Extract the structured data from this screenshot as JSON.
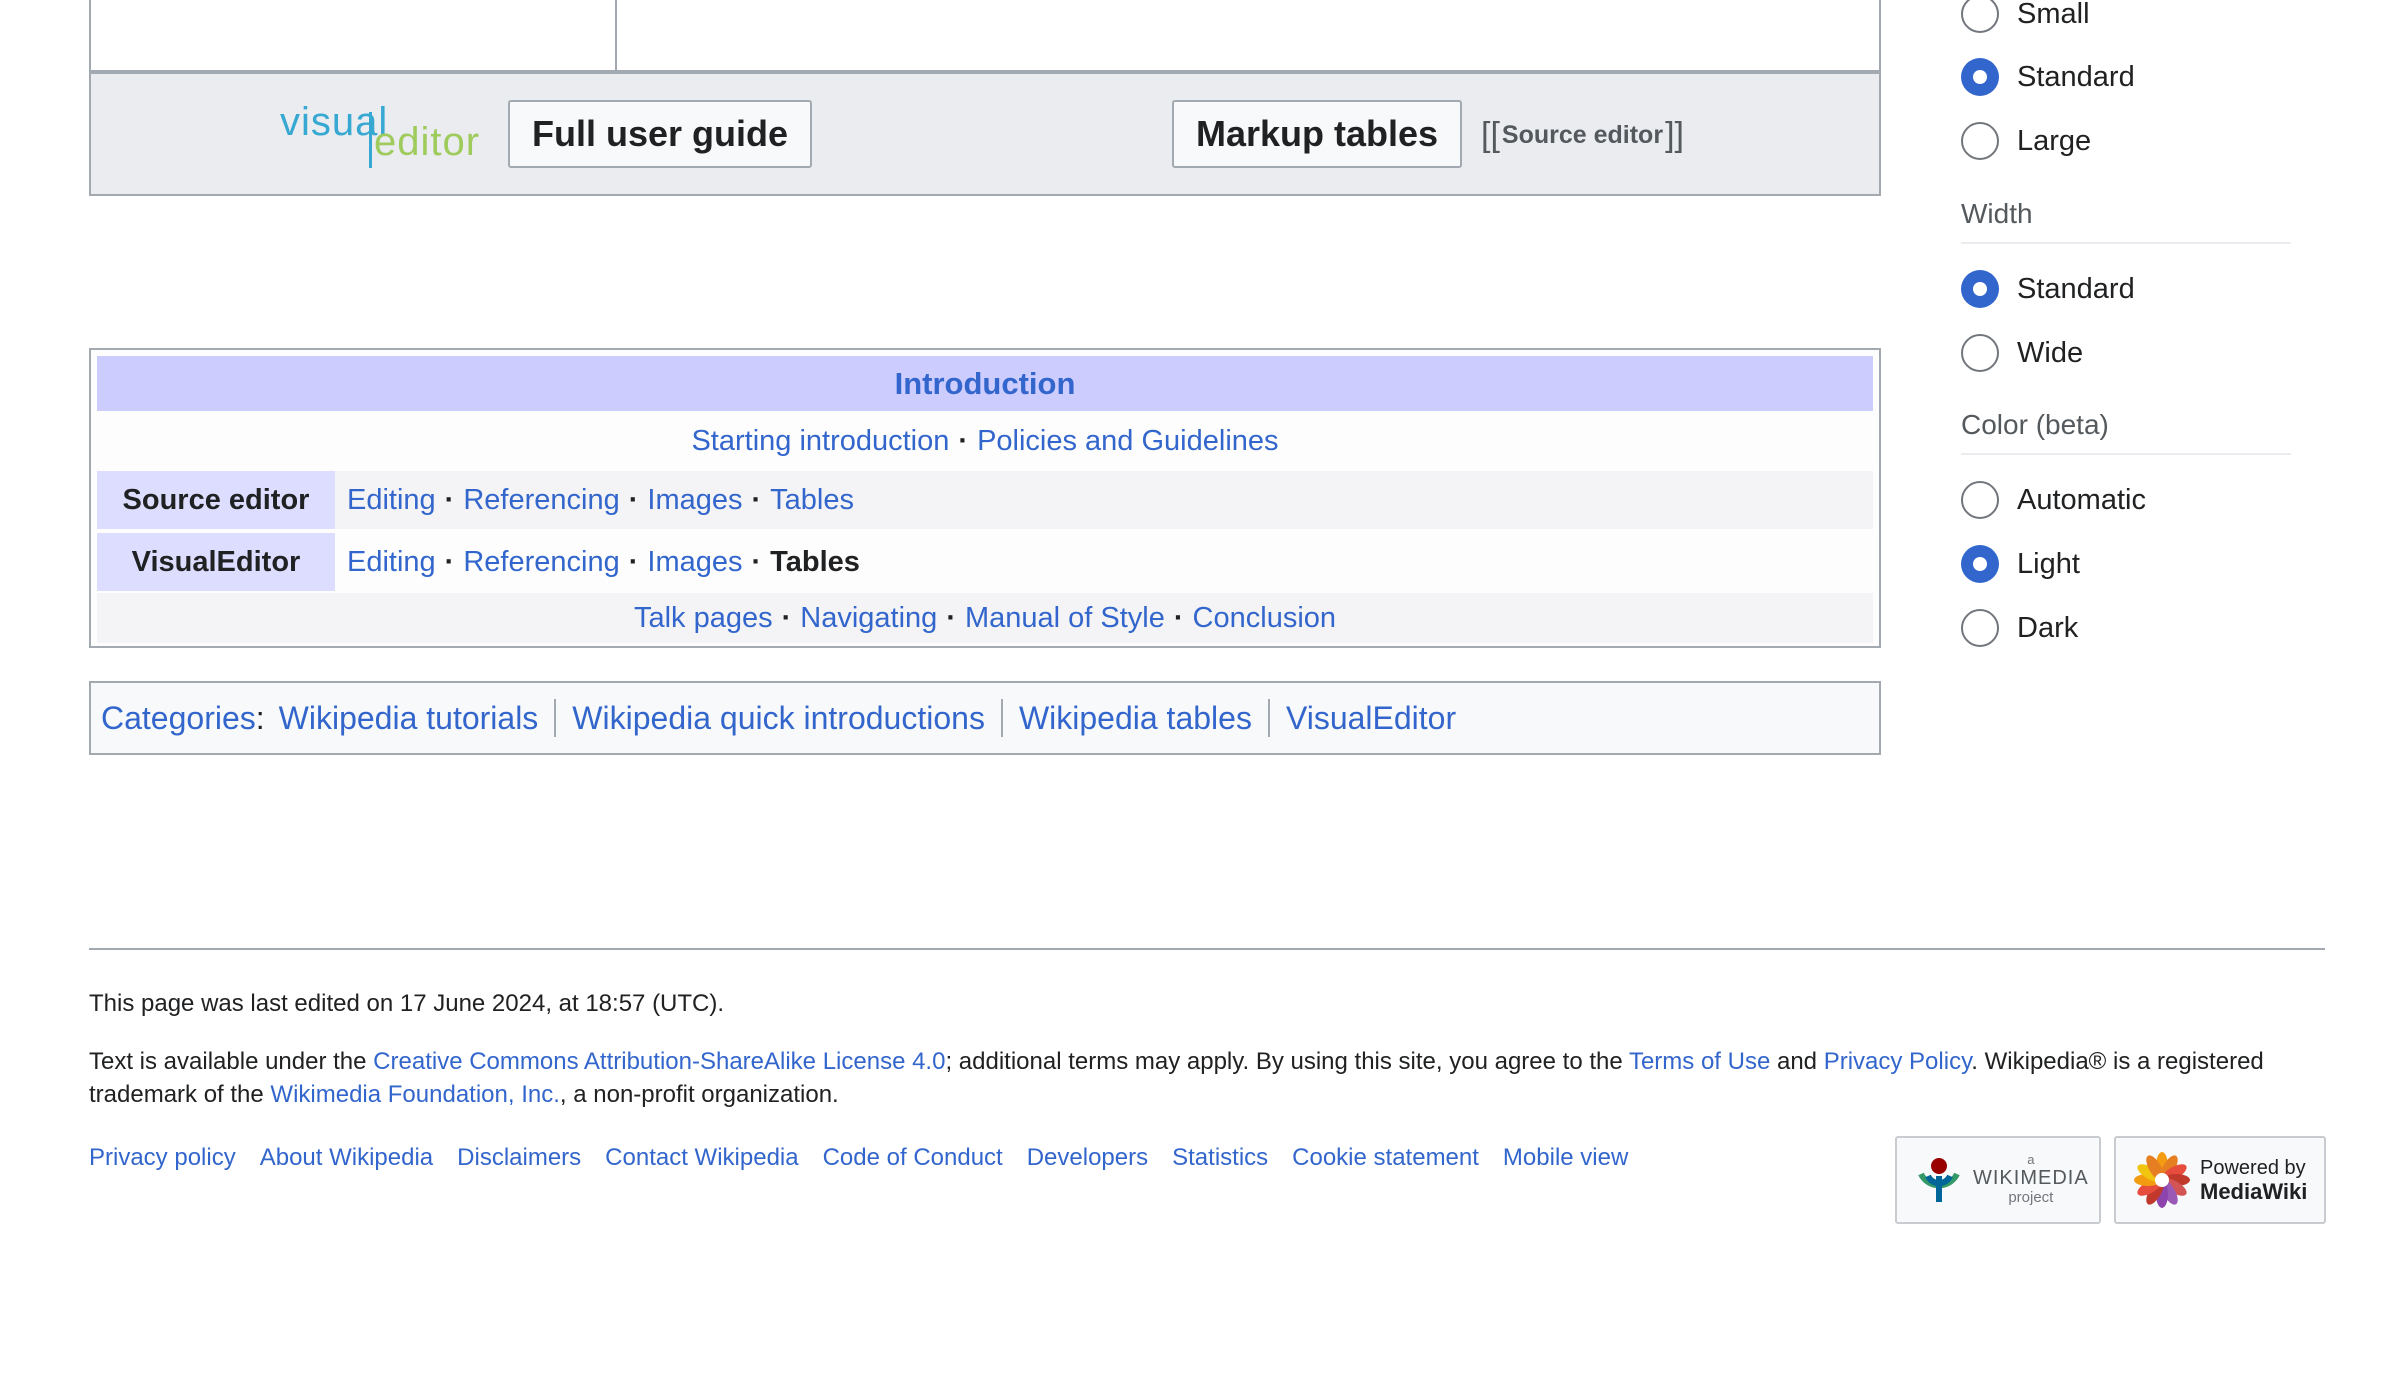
{
  "visual_editor_bar": {
    "logo_part1": "visual",
    "logo_part2": "editor",
    "full_user_guide": "Full user guide",
    "markup_tables": "Markup tables",
    "source_editor_open": "[[",
    "source_editor_label": "Source editor",
    "source_editor_close": "]]"
  },
  "navbox": {
    "title": "Introduction",
    "row1": {
      "link1": "Starting introduction",
      "link2": "Policies and Guidelines"
    },
    "source_editor": {
      "label": "Source editor",
      "links": [
        "Editing",
        "Referencing",
        "Images",
        "Tables"
      ]
    },
    "visual_editor": {
      "label": "VisualEditor",
      "links": [
        "Editing",
        "Referencing",
        "Images"
      ],
      "current": "Tables"
    },
    "last_row": [
      "Talk pages",
      "Navigating",
      "Manual of Style",
      "Conclusion"
    ],
    "separator": "·"
  },
  "categories": {
    "label": "Categories",
    "colon": ":",
    "items": [
      "Wikipedia tutorials",
      "Wikipedia quick introductions",
      "Wikipedia tables",
      "VisualEditor"
    ]
  },
  "appearance": {
    "text_options": [
      {
        "label": "Small",
        "selected": false
      },
      {
        "label": "Standard",
        "selected": true
      },
      {
        "label": "Large",
        "selected": false
      }
    ],
    "width_heading": "Width",
    "width_options": [
      {
        "label": "Standard",
        "selected": true
      },
      {
        "label": "Wide",
        "selected": false
      }
    ],
    "color_heading": "Color (beta)",
    "color_options": [
      {
        "label": "Automatic",
        "selected": false
      },
      {
        "label": "Light",
        "selected": true
      },
      {
        "label": "Dark",
        "selected": false
      }
    ]
  },
  "footer": {
    "last_edited": "This page was last edited on 17 June 2024, at 18:57 (UTC).",
    "license_prefix": "Text is available under the ",
    "license_link": "Creative Commons Attribution-ShareAlike License 4.0",
    "license_mid": "; additional terms may apply. By using this site, you agree to the ",
    "terms_link": "Terms of Use",
    "and": " and ",
    "privacy_link": "Privacy Policy",
    "trademark": ". Wikipedia® is a registered trademark of the ",
    "foundation_link": "Wikimedia Foundation, Inc.",
    "nonprofit": ", a non-profit organization.",
    "links": [
      "Privacy policy",
      "About Wikipedia",
      "Disclaimers",
      "Contact Wikipedia",
      "Code of Conduct",
      "Developers",
      "Statistics",
      "Cookie statement",
      "Mobile view"
    ],
    "wikimedia_badge": {
      "small": "a",
      "name": "WIKIMEDIA",
      "sub": "project"
    },
    "mediawiki_badge": {
      "line1": "Powered by",
      "line2": "MediaWiki"
    }
  },
  "colors": {
    "link": "#3366cc",
    "navbox_title_bg": "#ccccff",
    "navbox_group_bg": "#ddddff",
    "radio_selected": "#3366cc"
  }
}
